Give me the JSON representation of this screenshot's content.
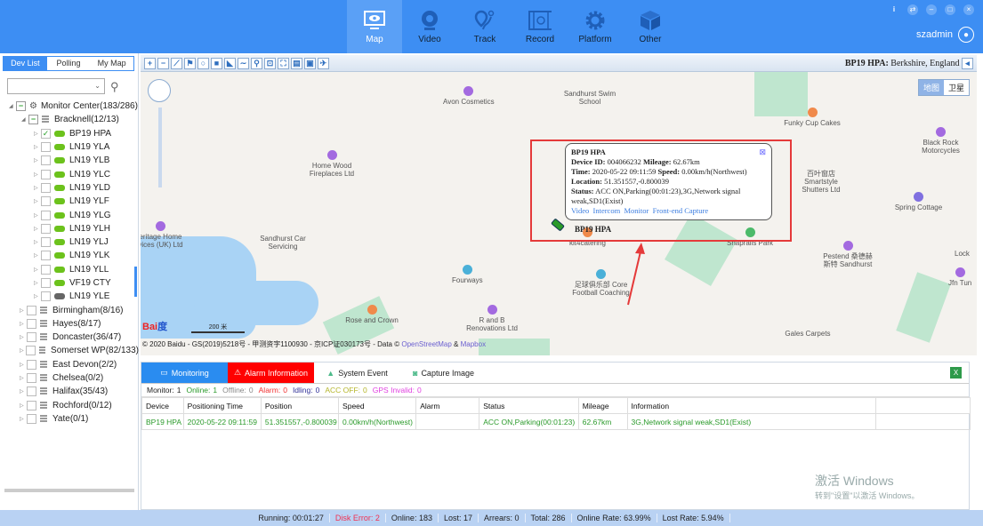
{
  "header": {
    "nav": [
      {
        "label": "Map",
        "icon": "monitor-eye-icon"
      },
      {
        "label": "Video",
        "icon": "webcam-icon"
      },
      {
        "label": "Track",
        "icon": "route-icon"
      },
      {
        "label": "Record",
        "icon": "film-icon"
      },
      {
        "label": "Platform",
        "icon": "gear-icon"
      },
      {
        "label": "Other",
        "icon": "cube-icon"
      }
    ],
    "window_buttons": [
      "i",
      "⇄",
      "–",
      "□",
      "×"
    ],
    "user": "szadmin"
  },
  "sidebar": {
    "tabs": [
      "Dev List",
      "Polling",
      "My Map"
    ],
    "select_value": "",
    "tree": [
      {
        "label": "Monitor Center(183/286)",
        "level": 0,
        "type": "root"
      },
      {
        "label": "Bracknell(12/13)",
        "level": 1,
        "type": "group"
      },
      {
        "label": "BP19 HPA",
        "type": "device",
        "checked": true,
        "online": true
      },
      {
        "label": "LN19 YLA",
        "type": "device",
        "online": true
      },
      {
        "label": "LN19 YLB",
        "type": "device",
        "online": true
      },
      {
        "label": "LN19 YLC",
        "type": "device",
        "online": true
      },
      {
        "label": "LN19 YLD",
        "type": "device",
        "online": true
      },
      {
        "label": "LN19 YLF",
        "type": "device",
        "online": true
      },
      {
        "label": "LN19 YLG",
        "type": "device",
        "online": true
      },
      {
        "label": "LN19 YLH",
        "type": "device",
        "online": true
      },
      {
        "label": "LN19 YLJ",
        "type": "device",
        "online": true
      },
      {
        "label": "LN19 YLK",
        "type": "device",
        "online": true
      },
      {
        "label": "LN19 YLL",
        "type": "device",
        "online": true
      },
      {
        "label": "VF19 CTY",
        "type": "device",
        "online": true
      },
      {
        "label": "LN19 YLE",
        "type": "device",
        "online": false
      },
      {
        "label": "Birmingham(8/16)",
        "type": "group2"
      },
      {
        "label": "Hayes(8/17)",
        "type": "group2"
      },
      {
        "label": "Doncaster(36/47)",
        "type": "group2"
      },
      {
        "label": "Somerset WP(82/133)",
        "type": "group2"
      },
      {
        "label": "East Devon(2/2)",
        "type": "group2"
      },
      {
        "label": "Chelsea(0/2)",
        "type": "group2"
      },
      {
        "label": "Halifax(35/43)",
        "type": "group2"
      },
      {
        "label": "Rochford(0/12)",
        "type": "group2"
      },
      {
        "label": "Yate(0/1)",
        "type": "group2"
      }
    ]
  },
  "map": {
    "location_device": "BP19 HPA:",
    "location_text": "Berkshire, England",
    "map_types": [
      "地图",
      "卫星"
    ],
    "labels": [
      "Avon Cosmetics",
      "Sandhurst Swim School",
      "Funky Cup Cakes",
      "Black Rock Motorcycles",
      "Home Wood Fireplaces Ltd",
      "百叶窗店 Smartstyle Shutters Ltd",
      "Spring Cottage",
      "eritage Home vices (UK) Ltd",
      "Sandhurst Car Servicing",
      "kit4catering",
      "Snaprails Park",
      "Pestend 桑德赫斯特 Sandhurst",
      "Lock",
      "Jfn Tun",
      "Fourways",
      "足球俱乐部 Core Football Coaching",
      "Rose and Crown",
      "R and B Renovations Ltd",
      "Gales Carpets"
    ],
    "scale": "200 米",
    "copyright": "© 2020 Baidu - GS(2019)5218号 - 甲测资字1100930 - 京ICP证030173号 - Data © ",
    "osm": "OpenStreetMap",
    "amp": " & ",
    "mapbox": "Mapbox",
    "marker_label": "BP19 HPA",
    "popup": {
      "title": "BP19 HPA",
      "device_id_label": "Device ID:",
      "device_id": "004066232",
      "mileage_label": "Mileage:",
      "mileage": "62.67km",
      "time_label": "Time:",
      "time": "2020-05-22 09:11:59",
      "speed_label": "Speed:",
      "speed": "0.00km/h(Northwest)",
      "location_label": "Location:",
      "location": "51.351557,-0.800039",
      "status_label": "Status:",
      "status": "ACC ON,Parking(00:01:23),3G,Network signal weak,SD1(Exist)",
      "links": [
        "Video",
        "Intercom",
        "Monitor",
        "Front-end Capture"
      ]
    }
  },
  "bottom": {
    "tabs": [
      "Monitoring",
      "Alarm Information",
      "System Event",
      "Capture Image"
    ],
    "stats": [
      {
        "label": "Monitor:",
        "value": "1",
        "color": "#222"
      },
      {
        "label": "Online:",
        "value": "1",
        "color": "#2a9a2a"
      },
      {
        "label": "Offline:",
        "value": "0",
        "color": "#888"
      },
      {
        "label": "Alarm:",
        "value": "0",
        "color": "#f03030"
      },
      {
        "label": "Idling:",
        "value": "0",
        "color": "#333399"
      },
      {
        "label": "ACC OFF:",
        "value": "0",
        "color": "#b5b52a"
      },
      {
        "label": "GPS Invalid:",
        "value": "0",
        "color": "#e040e0"
      }
    ],
    "columns": [
      "Device",
      "Positioning Time",
      "Position",
      "Speed",
      "Alarm",
      "Status",
      "Mileage",
      "Information",
      ""
    ],
    "rows": [
      [
        "BP19 HPA",
        "2020-05-22 09:11:59",
        "51.351557,-0.800039",
        "0.00km/h(Northwest)",
        "",
        "ACC ON,Parking(00:01:23)",
        "62.67km",
        "3G,Network signal weak,SD1(Exist)",
        ""
      ]
    ]
  },
  "statusbar": [
    {
      "text": "Running: 00:01:27"
    },
    {
      "text": "Disk Error: 2",
      "color": "#f03050"
    },
    {
      "text": "Online: 183"
    },
    {
      "text": "Lost: 17"
    },
    {
      "text": "Arrears: 0"
    },
    {
      "text": "Total: 286"
    },
    {
      "text": "Online Rate: 63.99%"
    },
    {
      "text": "Lost Rate: 5.94%"
    }
  ],
  "watermark": {
    "title": "激活 Windows",
    "sub": "转到\"设置\"以激活 Windows。"
  }
}
